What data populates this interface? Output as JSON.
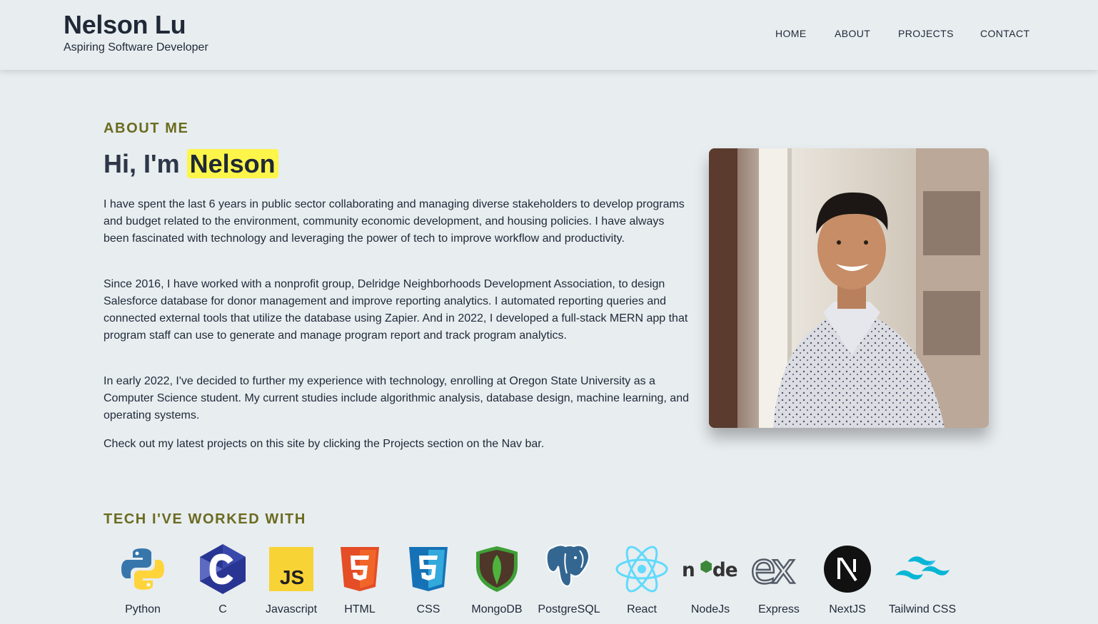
{
  "header": {
    "name": "Nelson Lu",
    "subtitle": "Aspiring Software Developer",
    "nav": [
      "HOME",
      "ABOUT",
      "PROJECTS",
      "CONTACT"
    ]
  },
  "about": {
    "section_title": "ABOUT ME",
    "greeting_prefix": "Hi, I'm",
    "greeting_name": "Nelson",
    "paragraphs": [
      "I have spent the last 6 years in public sector collaborating and managing diverse stakeholders to develop programs and budget related to the environment, community economic development, and housing policies. I have always been fascinated with technology and leveraging the power of tech to improve workflow and productivity.",
      "Since 2016, I have worked with a nonprofit group, Delridge Neighborhoods Development Association, to design Salesforce database for donor management and improve reporting analytics. I automated reporting queries and connected external tools that utilize the database using Zapier. And in 2022, I developed a full-stack MERN app that program staff can use to generate and manage program report and track program analytics.",
      "In early 2022, I've decided to further my experience with technology, enrolling at Oregon State University as a Computer Science student. My current studies include algorithmic analysis, database design, machine learning, and operating systems.",
      "Check out my latest projects on this site by clicking the Projects section on the Nav bar."
    ]
  },
  "tech": {
    "section_title": "TECH I'VE WORKED WITH",
    "items": [
      {
        "label": "Python",
        "icon": "python-icon"
      },
      {
        "label": "C",
        "icon": "c-icon"
      },
      {
        "label": "Javascript",
        "icon": "javascript-icon"
      },
      {
        "label": "HTML",
        "icon": "html-icon"
      },
      {
        "label": "CSS",
        "icon": "css-icon"
      },
      {
        "label": "MongoDB",
        "icon": "mongodb-icon"
      },
      {
        "label": "PostgreSQL",
        "icon": "postgresql-icon"
      },
      {
        "label": "React",
        "icon": "react-icon"
      },
      {
        "label": "NodeJs",
        "icon": "nodejs-icon"
      },
      {
        "label": "Express",
        "icon": "express-icon"
      },
      {
        "label": "NextJS",
        "icon": "nextjs-icon"
      },
      {
        "label": "Tailwind CSS",
        "icon": "tailwind-icon"
      }
    ]
  },
  "colors": {
    "background": "#e8edf0",
    "accent": "#6b6b1f",
    "highlight": "#fdf54a",
    "text": "#1f2937"
  }
}
